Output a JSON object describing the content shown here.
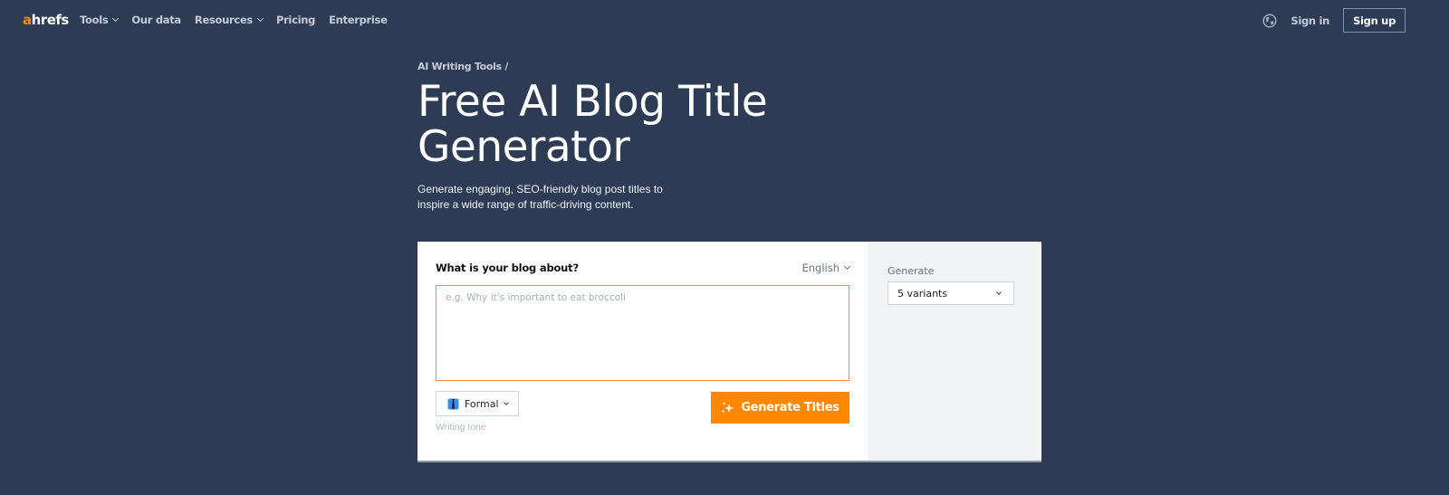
{
  "nav": {
    "logo_a": "a",
    "logo_rest": "hrefs",
    "links": [
      {
        "label": "Tools",
        "has_dropdown": true
      },
      {
        "label": "Our data",
        "has_dropdown": false
      },
      {
        "label": "Resources",
        "has_dropdown": true
      },
      {
        "label": "Pricing",
        "has_dropdown": false
      },
      {
        "label": "Enterprise",
        "has_dropdown": false
      }
    ],
    "globe_icon": "globe-icon",
    "sign_in": "Sign in",
    "sign_up": "Sign up"
  },
  "hero": {
    "breadcrumb": "AI Writing Tools /",
    "title": "Free AI Blog Title Generator",
    "subtitle": "Generate engaging, SEO-friendly blog post titles to inspire a wide range of traffic-driving content."
  },
  "form": {
    "question_label": "What is your blog about?",
    "language": "English",
    "textarea_value": "",
    "textarea_placeholder": "e.g. Why it's important to eat broccoli",
    "tone_value": "Formal",
    "tone_icon": "necktie-icon",
    "tone_caption": "Writing tone",
    "generate_button": "Generate Titles",
    "generate_icon": "sparkles-icon"
  },
  "side": {
    "generate_label": "Generate",
    "variants_value": "5 variants"
  },
  "colors": {
    "background": "#2e3b55",
    "accent": "#ff8800",
    "side_panel": "#f2f3f5"
  }
}
